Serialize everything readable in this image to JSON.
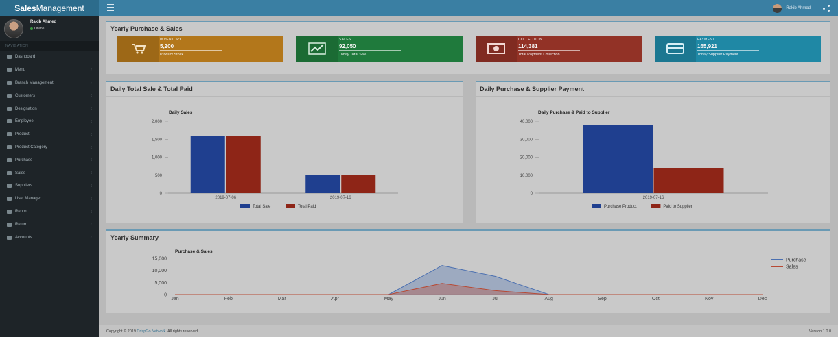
{
  "app": {
    "brand_bold": "Sales",
    "brand_rest": "Management"
  },
  "topbar": {
    "user_name": "Rakib Ahmed"
  },
  "sidebar": {
    "user": {
      "name": "Rakib Ahmed",
      "status": "Online"
    },
    "nav_header": "NAVIGATION",
    "items": [
      {
        "label": "Dashboard",
        "has_children": false
      },
      {
        "label": "Menu",
        "has_children": true
      },
      {
        "label": "Branch Management",
        "has_children": true
      },
      {
        "label": "Customers",
        "has_children": true
      },
      {
        "label": "Designation",
        "has_children": true
      },
      {
        "label": "Employee",
        "has_children": true
      },
      {
        "label": "Product",
        "has_children": true
      },
      {
        "label": "Product Category",
        "has_children": true
      },
      {
        "label": "Purchase",
        "has_children": true
      },
      {
        "label": "Sales",
        "has_children": true
      },
      {
        "label": "Suppliers",
        "has_children": true
      },
      {
        "label": "User Manager",
        "has_children": true
      },
      {
        "label": "Report",
        "has_children": true
      },
      {
        "label": "Return",
        "has_children": true
      },
      {
        "label": "Accounts",
        "has_children": true
      }
    ]
  },
  "yearly_box": {
    "title": "Yearly Purchase & Sales",
    "tiles": [
      {
        "label": "INVENTORY",
        "value": "5,200",
        "desc": "Product Stock",
        "color": "#b3771b",
        "icon": "cart-icon"
      },
      {
        "label": "SALES",
        "value": "92,050",
        "desc": "Today Total Sale",
        "color": "#1f7a3c",
        "icon": "trend-icon"
      },
      {
        "label": "COLLECTION",
        "value": "114,381",
        "desc": "Total Payment Collection",
        "color": "#923226",
        "icon": "money-icon"
      },
      {
        "label": "PAYMENT",
        "value": "165,921",
        "desc": "Today Supplier Payment",
        "color": "#1f88a5",
        "icon": "card-icon"
      }
    ]
  },
  "daily_sales_box": {
    "title": "Daily Total Sale & Total Paid"
  },
  "daily_purchase_box": {
    "title": "Daily Purchase & Supplier Payment"
  },
  "summary_box": {
    "title": "Yearly Summary"
  },
  "footer": {
    "copyright_prefix": "Copyright © 2019 ",
    "company": "CrispGo Network",
    "copyright_suffix": ". All rights reserved.",
    "version": "Version 1.0.0"
  },
  "chart_data": [
    {
      "type": "bar",
      "title": "Daily Sales",
      "categories": [
        "2019-07-06",
        "2019-07-16"
      ],
      "series": [
        {
          "name": "Total Sale",
          "values": [
            1600,
            500
          ],
          "color": "#1f3f8f"
        },
        {
          "name": "Total Paid",
          "values": [
            1600,
            500
          ],
          "color": "#8e2517"
        }
      ],
      "yticks": [
        "0",
        "500",
        "1,000",
        "1,500",
        "2,000"
      ],
      "ylim": [
        0,
        2000
      ],
      "legend": "bottom",
      "grid": false
    },
    {
      "type": "bar",
      "title": "Daily Purchase & Paid to Supplier",
      "categories": [
        "2019-07-16"
      ],
      "series": [
        {
          "name": "Purchase Product",
          "values": [
            38000
          ],
          "color": "#1f3f8f"
        },
        {
          "name": "Paid to Supplier",
          "values": [
            14000
          ],
          "color": "#8e2517"
        }
      ],
      "yticks": [
        "0",
        "10,000",
        "20,000",
        "30,000",
        "40,000"
      ],
      "ylim": [
        0,
        40000
      ],
      "legend": "bottom",
      "grid": false
    },
    {
      "type": "area",
      "title": "Purchase & Sales",
      "categories": [
        "Jan",
        "Feb",
        "Mar",
        "Apr",
        "May",
        "Jun",
        "Jul",
        "Aug",
        "Sep",
        "Oct",
        "Nov",
        "Dec"
      ],
      "series": [
        {
          "name": "Purchase",
          "values": [
            0,
            0,
            0,
            0,
            0,
            12000,
            7500,
            0,
            0,
            0,
            0,
            0
          ],
          "color": "#4a6fb0"
        },
        {
          "name": "Sales",
          "values": [
            0,
            0,
            0,
            0,
            0,
            4600,
            1600,
            0,
            0,
            0,
            0,
            0
          ],
          "color": "#b74a35"
        }
      ],
      "yticks": [
        "0",
        "5,000",
        "10,000",
        "15,000"
      ],
      "ylim": [
        0,
        15000
      ],
      "legend": "top-right",
      "grid": false
    }
  ]
}
